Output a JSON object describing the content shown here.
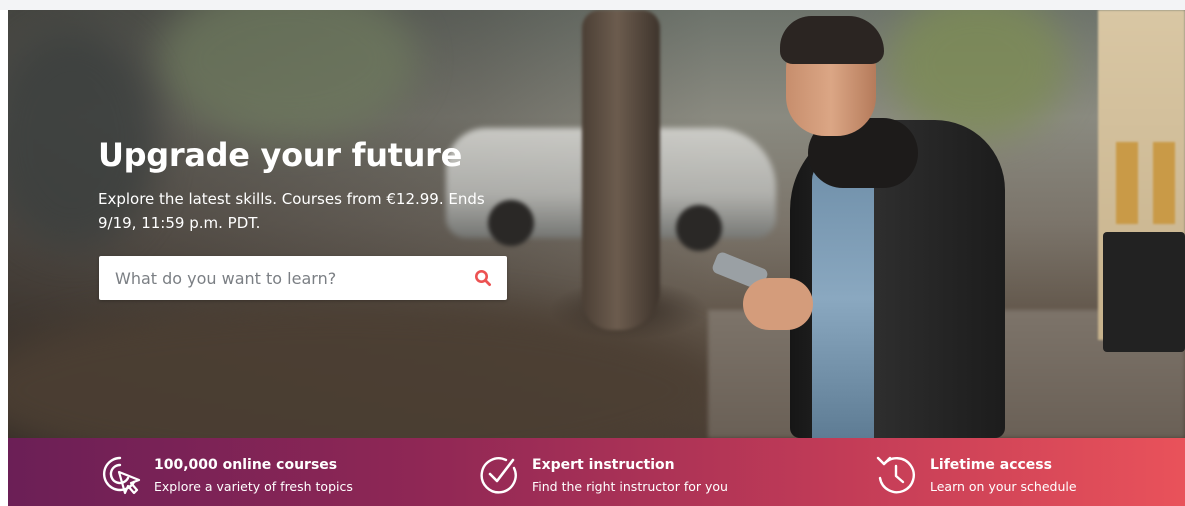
{
  "hero": {
    "title": "Upgrade your future",
    "subtitle": "Explore the latest skills. Courses from €12.99. Ends 9/19, 11:59 p.m. PDT.",
    "search": {
      "placeholder": "What do you want to learn?",
      "value": "",
      "icon": "search-icon"
    }
  },
  "features": [
    {
      "icon": "cursor-click-icon",
      "title": "100,000 online courses",
      "description": "Explore a variety of fresh topics"
    },
    {
      "icon": "checkmark-badge-icon",
      "title": "Expert instruction",
      "description": "Find the right instructor for you"
    },
    {
      "icon": "clock-history-icon",
      "title": "Lifetime access",
      "description": "Learn on your schedule"
    }
  ],
  "colors": {
    "accent": "#ec5252",
    "banner_start": "#6b1f56",
    "banner_end": "#e9525a",
    "text_on_dark": "#ffffff"
  }
}
